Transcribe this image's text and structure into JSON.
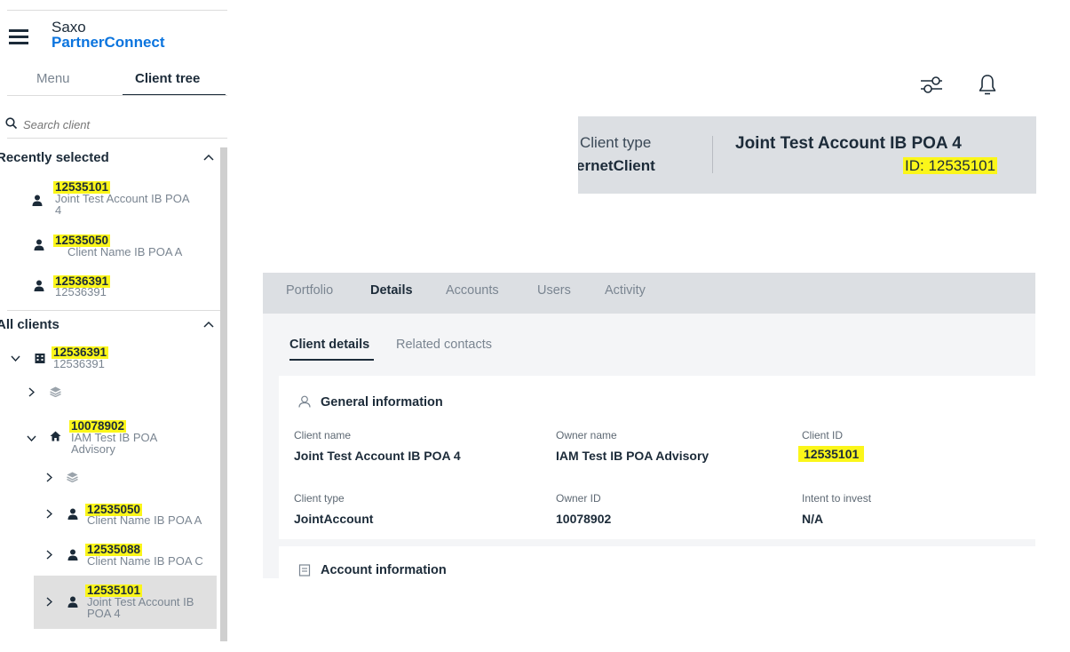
{
  "app": {
    "brand_line1": "Saxo",
    "brand_line2": "PartnerConnect"
  },
  "sidebar": {
    "tabs": [
      {
        "label": "Menu"
      },
      {
        "label": "Client tree"
      }
    ],
    "search": {
      "placeholder": "Search client"
    },
    "recent": {
      "title": "Recently selected",
      "items": [
        {
          "id": "12535101",
          "name_line1": "Joint Test Account IB POA",
          "name_line2": "4",
          "icon": "person-icon"
        },
        {
          "id": "12535050",
          "name_line1": "Client Name IB POA A",
          "icon": "person-icon"
        },
        {
          "id": "12536391",
          "name_line1": "12536391",
          "icon": "person-icon"
        }
      ]
    },
    "all": {
      "title": "All clients",
      "tree": [
        {
          "id": "12536391",
          "name_line1": "12536391",
          "icon": "building-icon",
          "expanded": true
        },
        {
          "icon": "layers-icon",
          "expanded": false
        },
        {
          "id": "10078902",
          "name_line1": "IAM Test IB POA",
          "name_line2": "Advisory",
          "icon": "home-icon",
          "expanded": true
        },
        {
          "icon": "layers-icon",
          "expanded": false
        },
        {
          "id": "12535050",
          "name_line1": "Client Name IB POA A",
          "icon": "person-icon",
          "expanded": false
        },
        {
          "id": "12535088",
          "name_line1": "Client Name IB POA C",
          "icon": "person-icon",
          "expanded": false
        },
        {
          "id": "12535101",
          "name_line1": "Joint Test Account IB",
          "name_line2": "POA 4",
          "icon": "person-icon",
          "expanded": false,
          "selected": true
        }
      ]
    }
  },
  "header": {
    "icons": [
      "filter-icon",
      "bell-icon"
    ]
  },
  "banner": {
    "type_label": "Client type",
    "type_value": "ernetClient",
    "client_name": "Joint Test Account IB POA 4",
    "client_id": "ID: 12535101"
  },
  "details": {
    "tabs": [
      {
        "label": "Portfolio"
      },
      {
        "label": "Details"
      },
      {
        "label": "Accounts"
      },
      {
        "label": "Users"
      },
      {
        "label": "Activity"
      }
    ],
    "active_tab": "Details",
    "subtabs": [
      {
        "label": "Client details"
      },
      {
        "label": "Related contacts"
      }
    ],
    "general": {
      "title": "General information",
      "fields": [
        {
          "label": "Client name",
          "value": "Joint Test Account IB POA 4"
        },
        {
          "label": "Owner name",
          "value": "IAM Test IB POA Advisory"
        },
        {
          "label": "Client ID",
          "value": "12535101"
        },
        {
          "label": "Client type",
          "value": "JointAccount"
        },
        {
          "label": "Owner ID",
          "value": "10078902"
        },
        {
          "label": "Intent to invest",
          "value": "N/A"
        }
      ]
    },
    "account": {
      "title": "Account information"
    }
  },
  "colors": {
    "brand_blue": "#0b74de",
    "highlight": "#fbf61a",
    "banner_bg": "#dcdfe3",
    "panel_bg": "#f4f5f7"
  }
}
